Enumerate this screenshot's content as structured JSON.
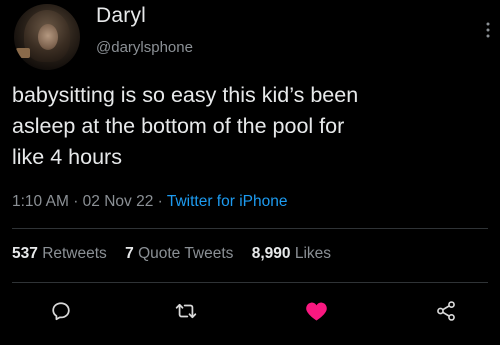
{
  "author": {
    "name": "Daryl",
    "handle": "@darylsphone"
  },
  "tweet": {
    "lines": [
      "babysitting is so easy this kid’s been",
      "asleep at the bottom of the pool for",
      "like 4 hours"
    ],
    "time": "1:10 AM",
    "date": "02 Nov 22",
    "separator": "·",
    "source": "Twitter for iPhone"
  },
  "stats": {
    "retweets_count": "537",
    "retweets_label": "Retweets",
    "quote_count": "7",
    "quote_label": "Quote Tweets",
    "likes_count": "8,990",
    "likes_label": "Likes"
  },
  "actions": {
    "reply_icon": "reply-icon",
    "retweet_icon": "retweet-icon",
    "like_icon": "heart-icon",
    "like_color": "#f91880",
    "share_icon": "share-icon"
  },
  "colors": {
    "background": "#000000",
    "text": "#e7e9ea",
    "secondary": "#8b9095",
    "link": "#1d9bf0",
    "divider": "#2f3336"
  }
}
